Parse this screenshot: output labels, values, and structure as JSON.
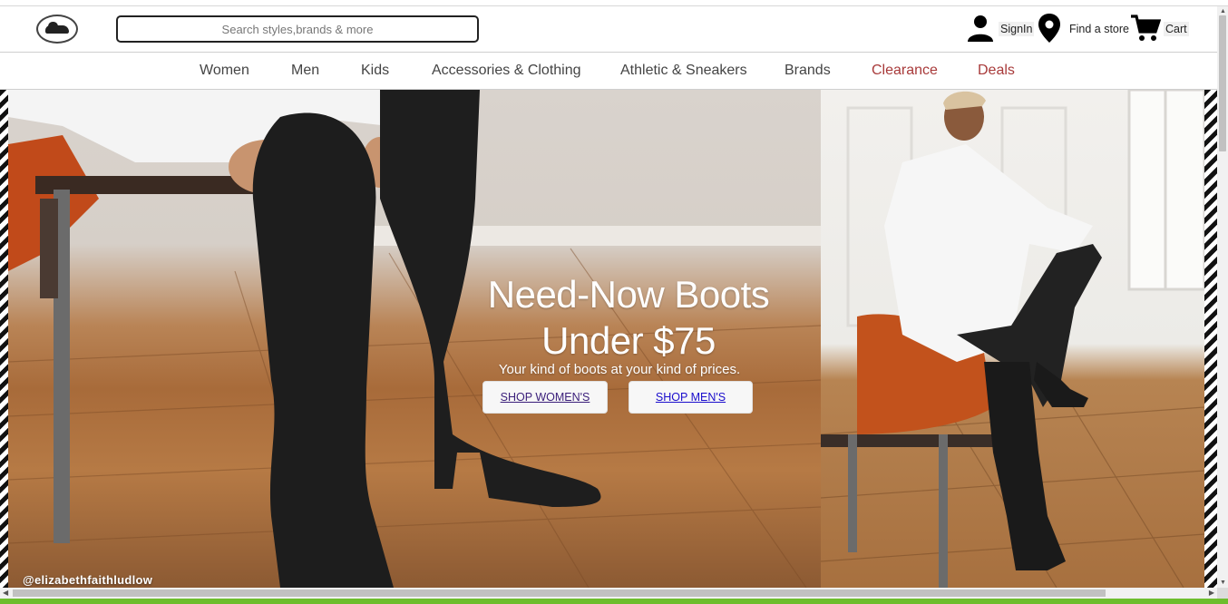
{
  "header": {
    "search_placeholder": "Search styles,brands & more",
    "signin_label": "SignIn",
    "store_label": "Find a store",
    "cart_label": "Cart"
  },
  "nav": {
    "items": [
      {
        "label": "Women"
      },
      {
        "label": "Men"
      },
      {
        "label": "Kids"
      },
      {
        "label": "Accessories & Clothing"
      },
      {
        "label": "Athletic & Sneakers"
      },
      {
        "label": "Brands"
      },
      {
        "label": "Clearance"
      },
      {
        "label": "Deals"
      }
    ]
  },
  "hero": {
    "headline_line1": "Need-Now Boots",
    "headline_line2": "Under $75",
    "subtitle": "Your kind of boots at your kind of prices.",
    "cta_women": "SHOP WOMEN'S",
    "cta_men": "SHOP MEN'S",
    "photo_credit": "@elizabethfaithludlow"
  },
  "colors": {
    "accent_red": "#a83a3a",
    "bottom_bar": "#6dbd2d",
    "link_blue": "#1a0dcc"
  }
}
